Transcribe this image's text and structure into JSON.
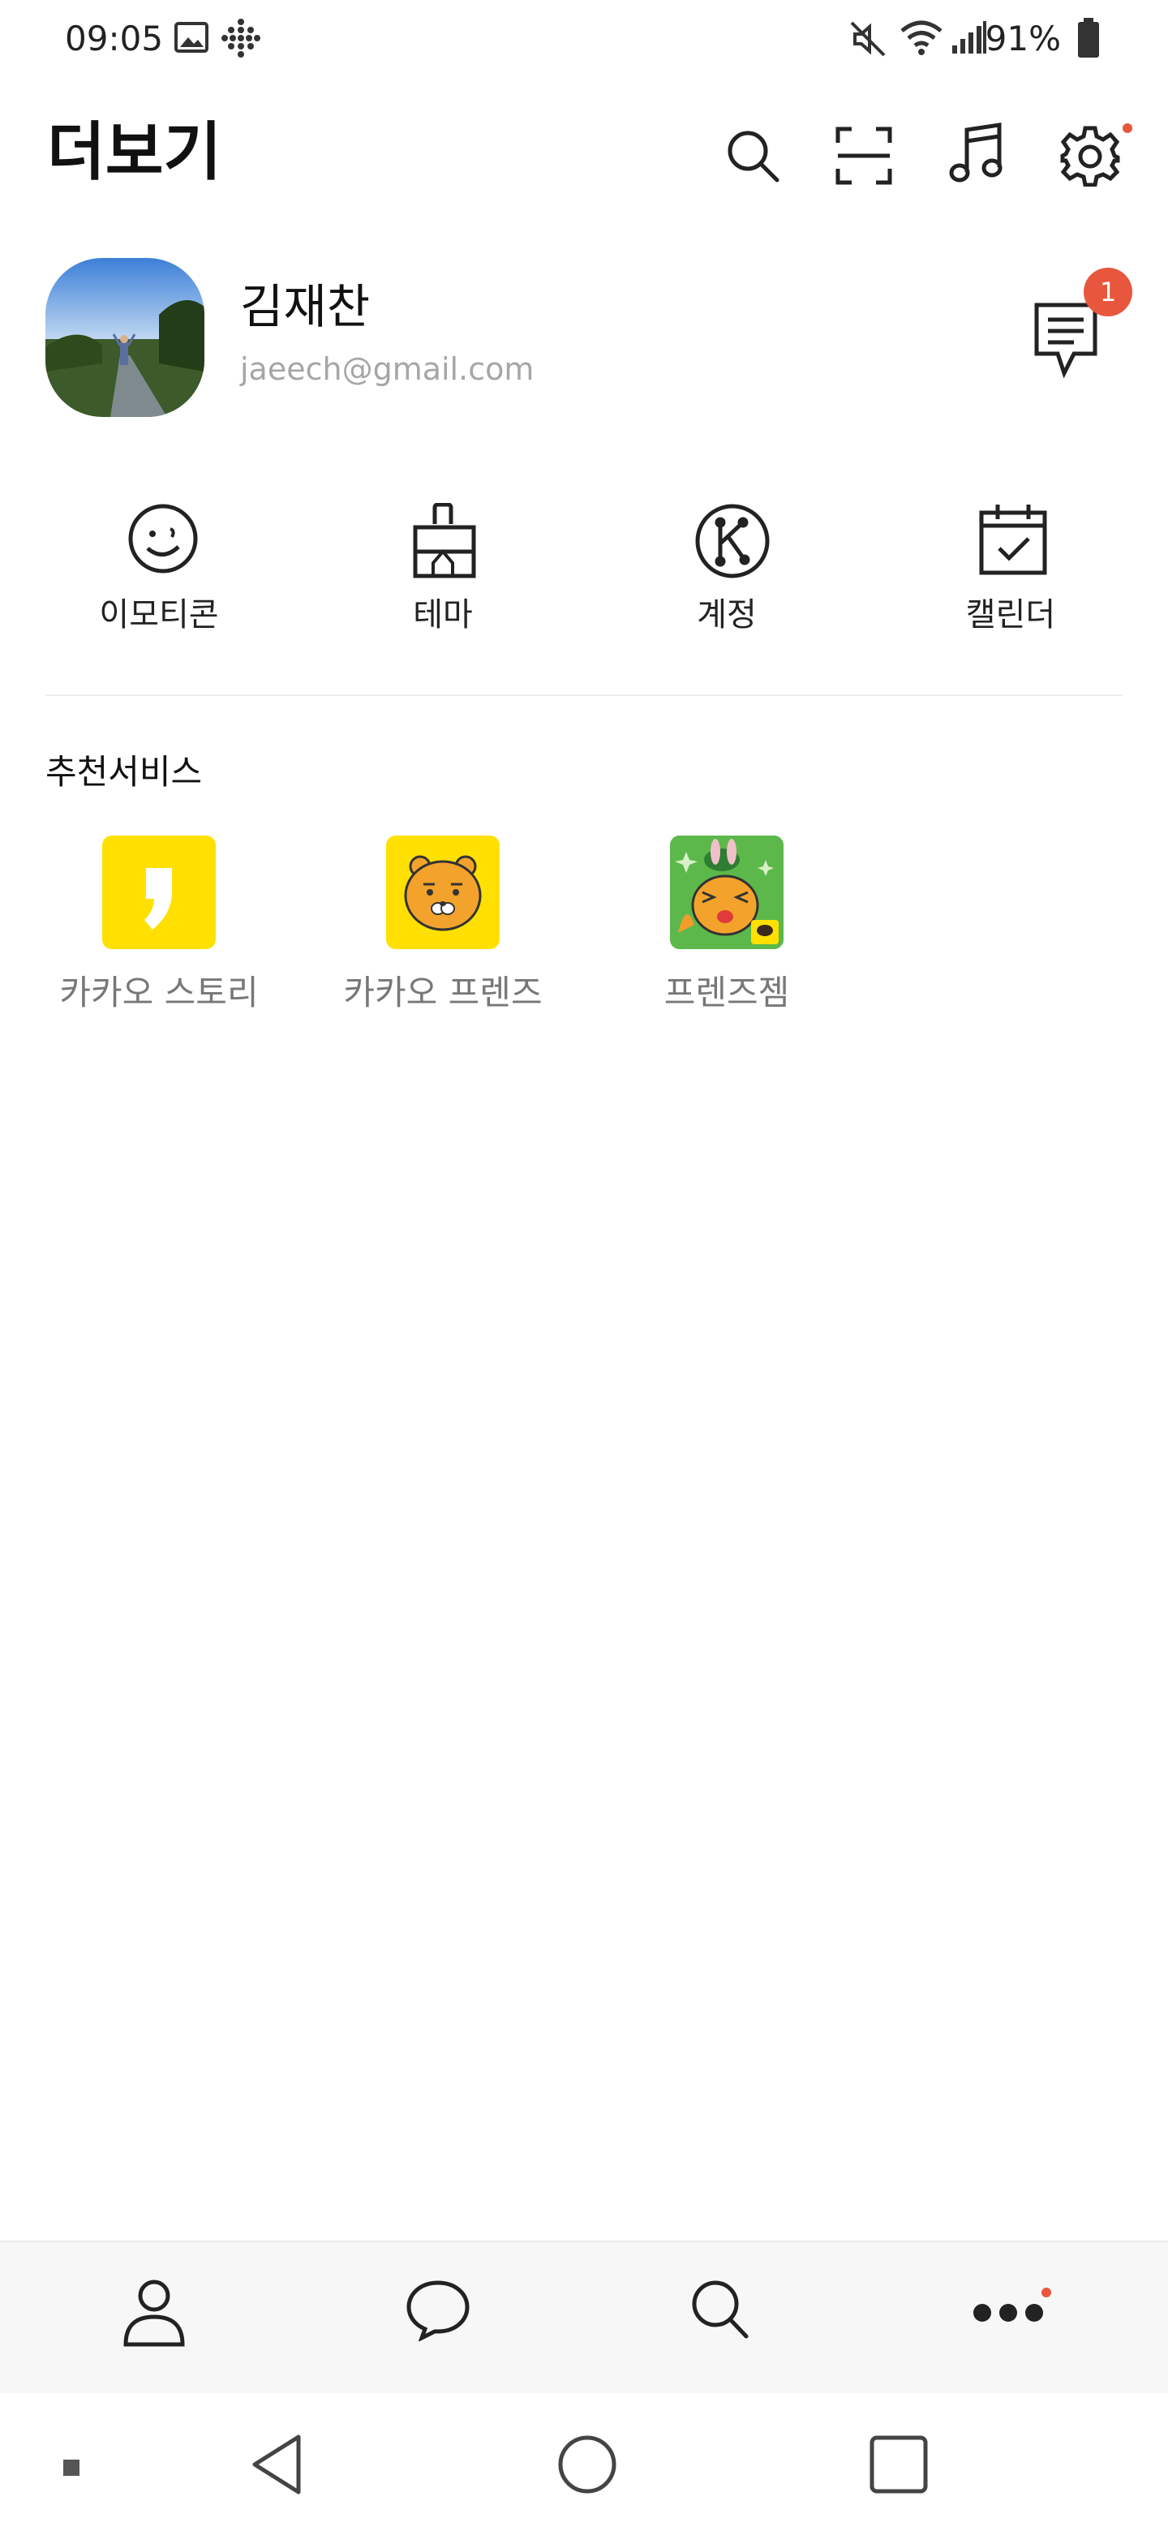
{
  "status_bar": {
    "time": "09:05",
    "battery": "91%",
    "icons": [
      "gallery-icon",
      "dots-grid-icon",
      "mute-icon",
      "wifi-icon",
      "signal-icon",
      "battery-icon"
    ]
  },
  "header": {
    "title": "더보기",
    "actions": [
      "search-icon",
      "scan-icon",
      "music-icon",
      "settings-icon"
    ]
  },
  "profile": {
    "name": "김재찬",
    "email": "jaeech@gmail.com",
    "chat_badge": "1"
  },
  "quick_menu": [
    {
      "label": "이모티콘",
      "icon": "emoticon-icon"
    },
    {
      "label": "테마",
      "icon": "theme-brush-icon"
    },
    {
      "label": "계정",
      "icon": "kakao-account-icon"
    },
    {
      "label": "캘린더",
      "icon": "calendar-icon"
    }
  ],
  "recommended": {
    "title": "추천서비스",
    "items": [
      {
        "label": "카카오 스토리",
        "icon": "kakao-story-icon"
      },
      {
        "label": "카카오 프렌즈",
        "icon": "kakao-friends-icon"
      },
      {
        "label": "프렌즈젬",
        "icon": "friends-gem-icon"
      }
    ]
  },
  "tabs": [
    "friends-tab-icon",
    "chats-tab-icon",
    "search-tab-icon",
    "more-tab-icon"
  ],
  "colors": {
    "accent_red": "#e8573d",
    "kakao_yellow": "#ffe000"
  }
}
